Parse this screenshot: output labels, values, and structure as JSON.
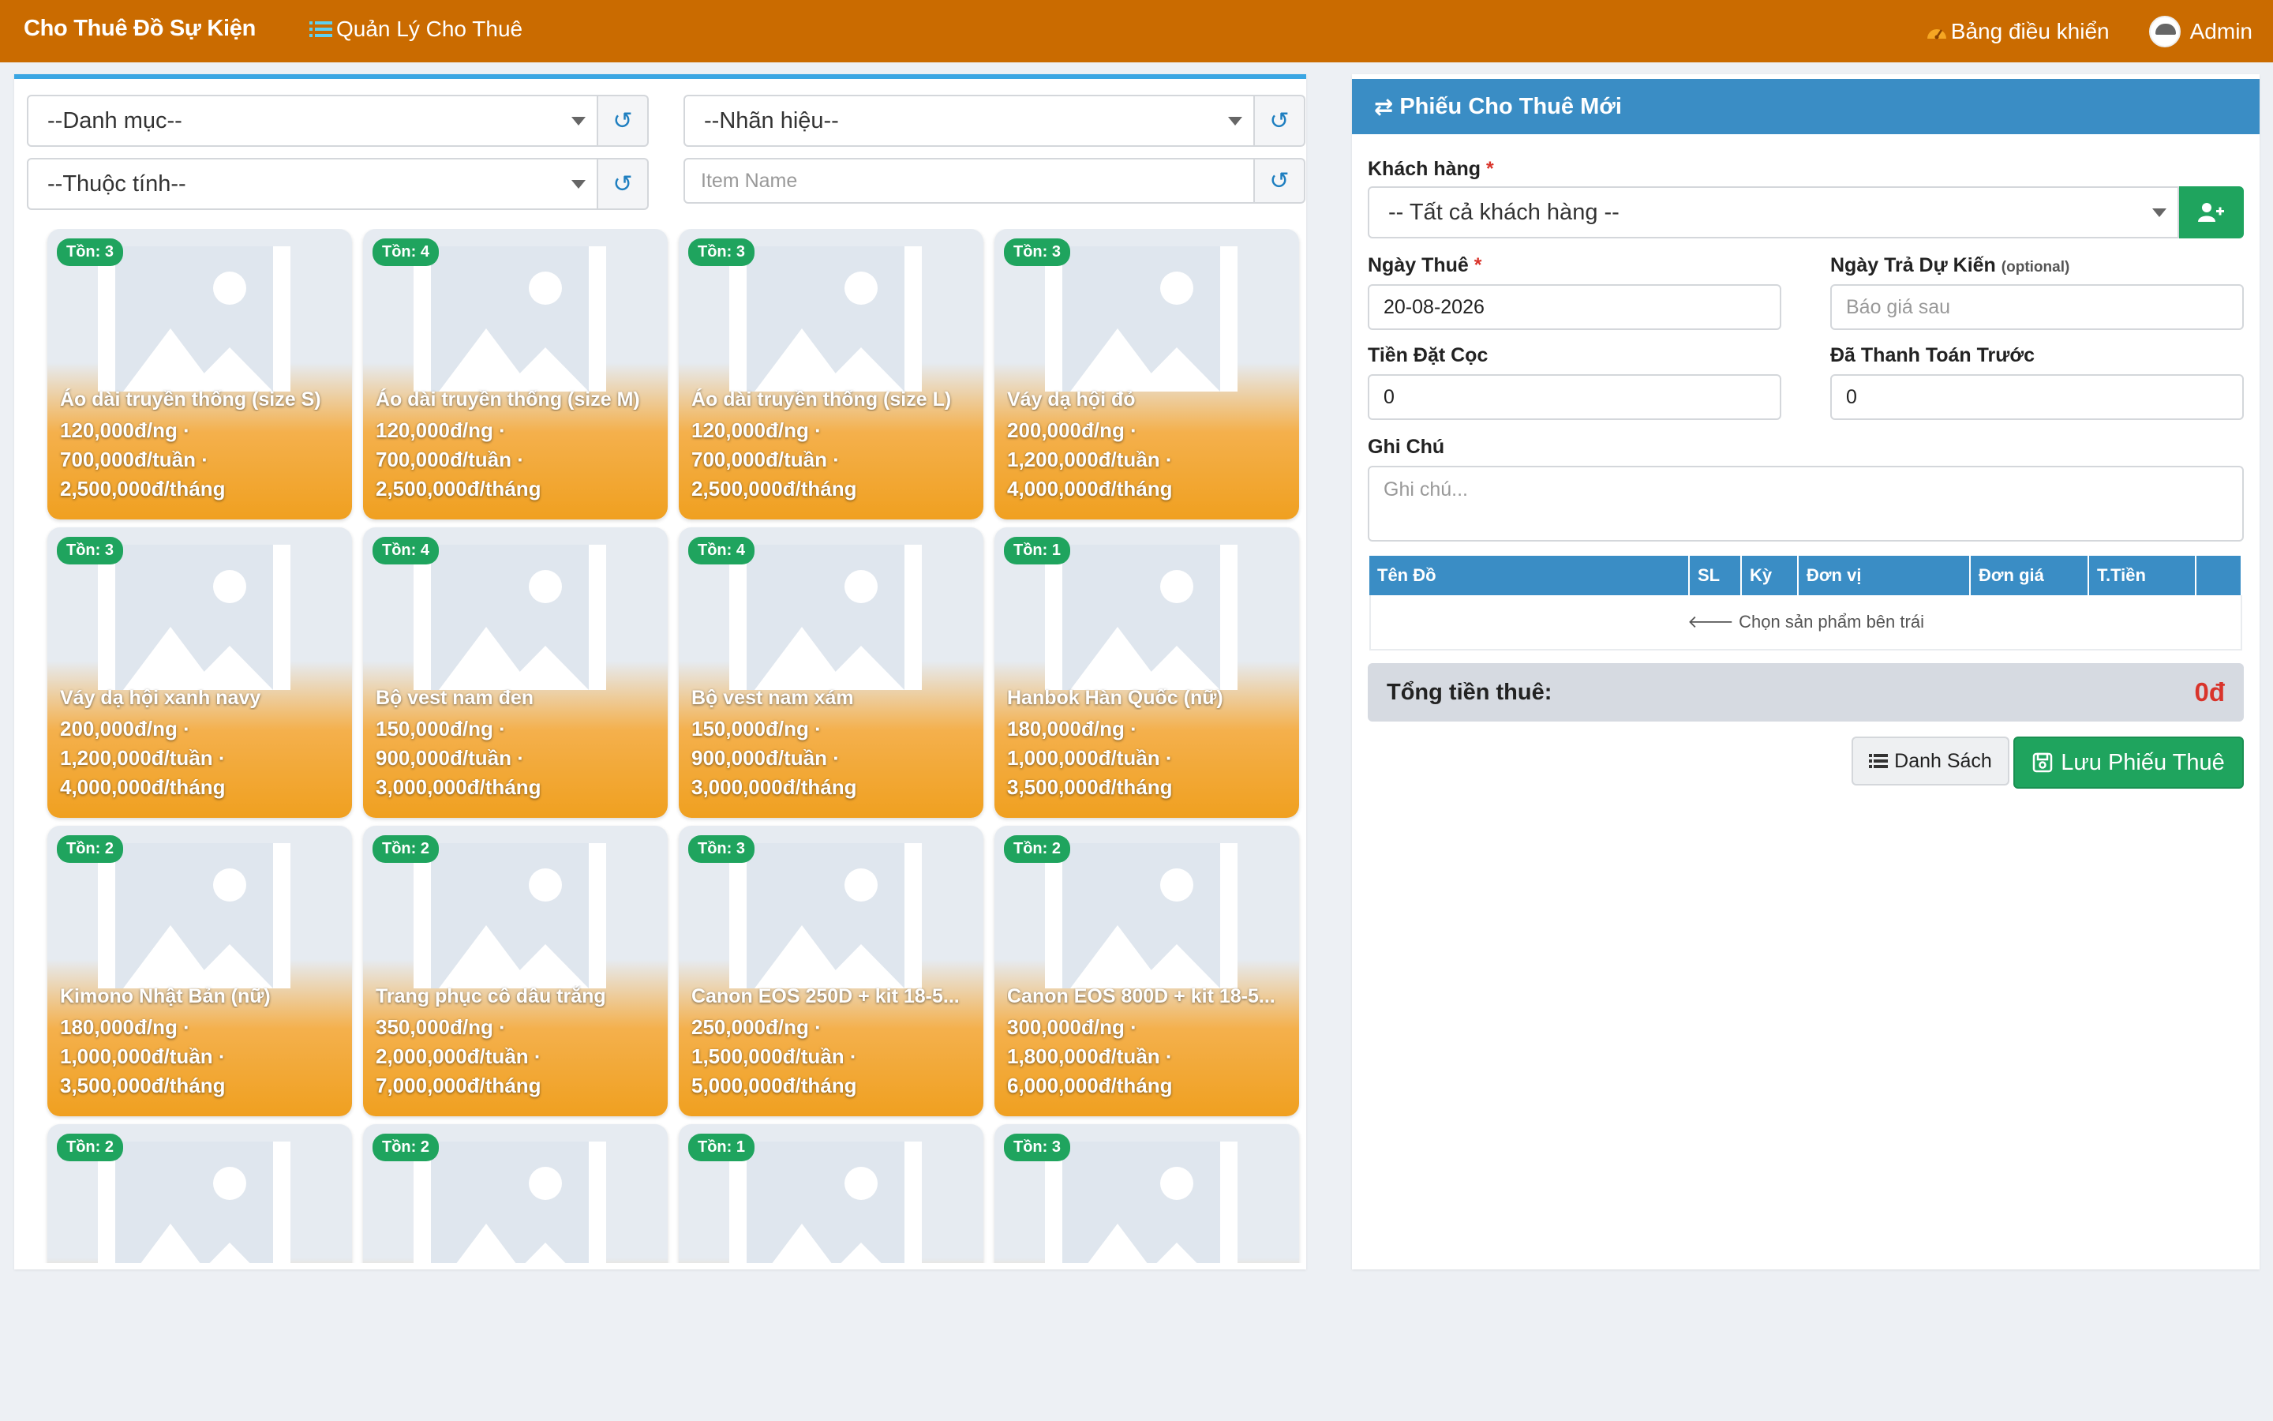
{
  "navbar": {
    "brand": "Cho Thuê Đồ Sự Kiện",
    "menu_link": "Quản Lý Cho Thuê",
    "dashboard": "Bảng điều khiển",
    "user": "Admin",
    "color": "#ca6b00"
  },
  "filters": {
    "category": "--Danh mục--",
    "brand": "--Nhãn hiệu--",
    "attribute": "--Thuộc tính--",
    "item_name_placeholder": "Item Name"
  },
  "products": [
    {
      "stock": "Tồn: 3",
      "name": "Áo dài truyền thống (size S)",
      "day": "120,000đ/ng ·",
      "week": "700,000đ/tuần ·",
      "month": "2,500,000đ/tháng"
    },
    {
      "stock": "Tồn: 4",
      "name": "Áo dài truyền thống (size M)",
      "day": "120,000đ/ng ·",
      "week": "700,000đ/tuần ·",
      "month": "2,500,000đ/tháng"
    },
    {
      "stock": "Tồn: 3",
      "name": "Áo dài truyền thống (size L)",
      "day": "120,000đ/ng ·",
      "week": "700,000đ/tuần ·",
      "month": "2,500,000đ/tháng"
    },
    {
      "stock": "Tồn: 3",
      "name": "Váy dạ hội đỏ",
      "day": "200,000đ/ng ·",
      "week": "1,200,000đ/tuần ·",
      "month": "4,000,000đ/tháng"
    },
    {
      "stock": "Tồn: 3",
      "name": "Váy dạ hội xanh navy",
      "day": "200,000đ/ng ·",
      "week": "1,200,000đ/tuần ·",
      "month": "4,000,000đ/tháng"
    },
    {
      "stock": "Tồn: 4",
      "name": "Bộ vest nam đen",
      "day": "150,000đ/ng ·",
      "week": "900,000đ/tuần ·",
      "month": "3,000,000đ/tháng"
    },
    {
      "stock": "Tồn: 4",
      "name": "Bộ vest nam xám",
      "day": "150,000đ/ng ·",
      "week": "900,000đ/tuần ·",
      "month": "3,000,000đ/tháng"
    },
    {
      "stock": "Tồn: 1",
      "name": "Hanbok Hàn Quốc (nữ)",
      "day": "180,000đ/ng ·",
      "week": "1,000,000đ/tuần ·",
      "month": "3,500,000đ/tháng"
    },
    {
      "stock": "Tồn: 2",
      "name": "Kimono Nhật Bản (nữ)",
      "day": "180,000đ/ng ·",
      "week": "1,000,000đ/tuần ·",
      "month": "3,500,000đ/tháng"
    },
    {
      "stock": "Tồn: 2",
      "name": "Trang phục cô dâu trắng",
      "day": "350,000đ/ng ·",
      "week": "2,000,000đ/tuần ·",
      "month": "7,000,000đ/tháng"
    },
    {
      "stock": "Tồn: 3",
      "name": "Canon EOS 250D + kit 18-5...",
      "day": "250,000đ/ng ·",
      "week": "1,500,000đ/tuần ·",
      "month": "5,000,000đ/tháng"
    },
    {
      "stock": "Tồn: 2",
      "name": "Canon EOS 800D + kit 18-5...",
      "day": "300,000đ/ng ·",
      "week": "1,800,000đ/tuần ·",
      "month": "6,000,000đ/tháng"
    },
    {
      "stock": "Tồn: 2",
      "name": "",
      "day": "",
      "week": "",
      "month": ""
    },
    {
      "stock": "Tồn: 2",
      "name": "",
      "day": "",
      "week": "",
      "month": ""
    },
    {
      "stock": "Tồn: 1",
      "name": "",
      "day": "",
      "week": "",
      "month": ""
    },
    {
      "stock": "Tồn: 3",
      "name": "",
      "day": "",
      "week": "",
      "month": ""
    }
  ],
  "form": {
    "title": "Phiếu Cho Thuê Mới",
    "customer_label": "Khách hàng",
    "customer_value": "-- Tất cả khách hàng --",
    "rent_date_label": "Ngày Thuê",
    "rent_date_value": "20-08-2026",
    "return_date_label": "Ngày Trả Dự Kiến",
    "return_date_optional": "(optional)",
    "return_date_placeholder": "Báo giá sau",
    "deposit_label": "Tiền Đặt Cọc",
    "deposit_value": "0",
    "prepaid_label": "Đã Thanh Toán Trước",
    "prepaid_value": "0",
    "note_label": "Ghi Chú",
    "note_placeholder": "Ghi chú...",
    "required_mark": "*"
  },
  "table": {
    "columns": [
      "Tên Đồ",
      "SL",
      "Kỳ",
      "Đơn vị",
      "Đơn giá",
      "T.Tiền",
      ""
    ],
    "empty": "Chọn sản phẩm bên trái"
  },
  "summary": {
    "label": "Tổng tiền thuê:",
    "value": "0đ"
  },
  "actions": {
    "list": "Danh Sách",
    "save": "Lưu Phiếu Thuê"
  },
  "colors": {
    "accent": "#3a8dc5",
    "success": "#1fa45e",
    "danger": "#d9342b",
    "card": "#f0a020"
  }
}
